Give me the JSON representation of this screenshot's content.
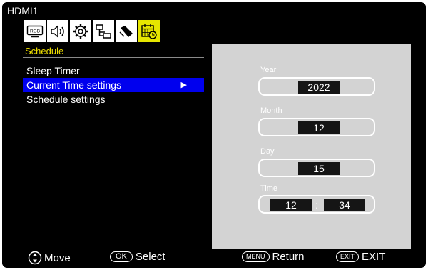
{
  "source_name": "HDMI1",
  "icon_tabs": [
    {
      "name": "rgb-picture-icon",
      "label": "RGB",
      "active": false
    },
    {
      "name": "speaker-icon",
      "active": false
    },
    {
      "name": "gear-icon",
      "active": false
    },
    {
      "name": "network-icon",
      "active": false
    },
    {
      "name": "protect-icon",
      "active": false
    },
    {
      "name": "schedule-icon",
      "active": true
    }
  ],
  "menu_title": "Schedule",
  "menu_items": [
    {
      "label": "Sleep Timer",
      "selected": false
    },
    {
      "label": "Current Time settings",
      "selected": true,
      "arrow": "▶"
    },
    {
      "label": "Schedule settings",
      "selected": false
    }
  ],
  "fields": {
    "year": {
      "label": "Year",
      "value": "2022"
    },
    "month": {
      "label": "Month",
      "value": "12"
    },
    "day": {
      "label": "Day",
      "value": "15"
    },
    "time": {
      "label": "Time",
      "hour": "12",
      "separator": ":",
      "minute": "34"
    }
  },
  "footer": {
    "move_label": "Move",
    "ok_key": "OK",
    "select_label": "Select",
    "menu_key": "MENU",
    "return_label": "Return",
    "exit_key": "EXIT",
    "exit_label": "EXIT"
  },
  "colors": {
    "background": "#000000",
    "menu_title": "#f0e000",
    "selection": "#0000ee",
    "active_tab": "#e6e600",
    "panel": "#d3d3d3"
  }
}
